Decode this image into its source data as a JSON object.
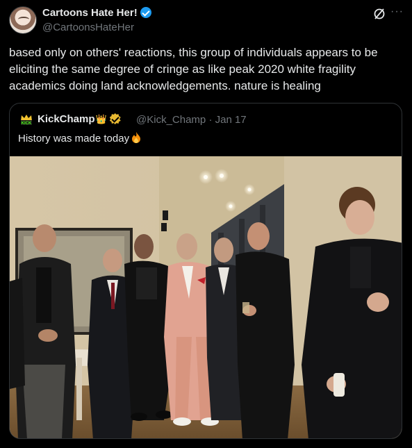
{
  "tweet": {
    "author_name": "Cartoons Hate Her!",
    "author_handle": "@CartoonsHateHer",
    "text": "based only on others' reactions, this group of individuals appears to be eliciting the same degree of cringe as like peak 2020 white fragility academics doing land acknowledgements. nature is healing",
    "more_label": "···"
  },
  "quote": {
    "author_name": "KickChamp",
    "crown": "👑",
    "handle": "@Kick_Champ",
    "separator": "·",
    "date": "Jan 17",
    "text": "History was made today",
    "avatar_text": "KICK"
  },
  "colors": {
    "background": "#000000",
    "text": "#e7e9ea",
    "secondary": "#71767b",
    "border": "#2f3336",
    "verified_blue": "#1d9bf0",
    "verified_gold": "#e8b931"
  }
}
